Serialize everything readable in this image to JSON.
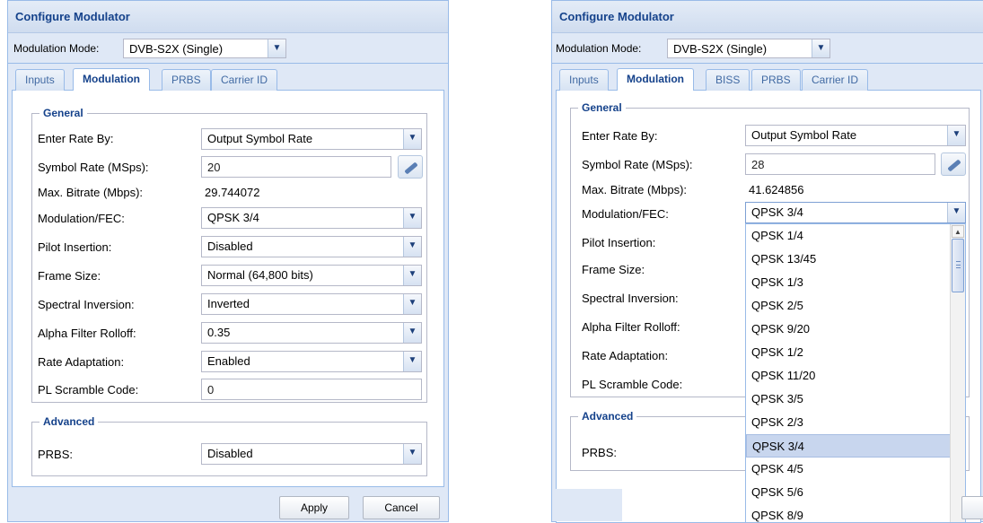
{
  "left": {
    "title": "Configure Modulator",
    "mode_label": "Modulation Mode:",
    "mode_value": "DVB-S2X (Single)",
    "tabs": [
      "Inputs",
      "Modulation",
      "PRBS",
      "Carrier ID"
    ],
    "general_legend": "General",
    "fields": {
      "enter_rate_by": {
        "label": "Enter Rate By:",
        "value": "Output Symbol Rate"
      },
      "symbol_rate": {
        "label": "Symbol Rate (MSps):",
        "value": "20"
      },
      "max_bitrate": {
        "label": "Max. Bitrate (Mbps):",
        "value": "29.744072"
      },
      "modulation_fec": {
        "label": "Modulation/FEC:",
        "value": "QPSK 3/4"
      },
      "pilot_insertion": {
        "label": "Pilot Insertion:",
        "value": "Disabled"
      },
      "frame_size": {
        "label": "Frame Size:",
        "value": "Normal (64,800 bits)"
      },
      "spectral_inversion": {
        "label": "Spectral Inversion:",
        "value": "Inverted"
      },
      "alpha_rolloff": {
        "label": "Alpha Filter Rolloff:",
        "value": "0.35"
      },
      "rate_adaptation": {
        "label": "Rate Adaptation:",
        "value": "Enabled"
      },
      "pl_scramble": {
        "label": "PL Scramble Code:",
        "value": "0"
      }
    },
    "advanced_legend": "Advanced",
    "prbs": {
      "label": "PRBS:",
      "value": "Disabled"
    },
    "apply_label": "Apply",
    "cancel_label": "Cancel"
  },
  "right": {
    "title": "Configure Modulator",
    "mode_label": "Modulation Mode:",
    "mode_value": "DVB-S2X (Single)",
    "tabs": [
      "Inputs",
      "Modulation",
      "BISS",
      "PRBS",
      "Carrier ID"
    ],
    "general_legend": "General",
    "fields": {
      "enter_rate_by": {
        "label": "Enter Rate By:",
        "value": "Output Symbol Rate"
      },
      "symbol_rate": {
        "label": "Symbol Rate (MSps):",
        "value": "28"
      },
      "max_bitrate": {
        "label": "Max. Bitrate (Mbps):",
        "value": "41.624856"
      },
      "modulation_fec": {
        "label": "Modulation/FEC:",
        "value": "QPSK 3/4"
      },
      "pilot_insertion": {
        "label": "Pilot Insertion:"
      },
      "frame_size": {
        "label": "Frame Size:"
      },
      "spectral_inversion": {
        "label": "Spectral Inversion:"
      },
      "alpha_rolloff": {
        "label": "Alpha Filter Rolloff:"
      },
      "rate_adaptation": {
        "label": "Rate Adaptation:"
      },
      "pl_scramble": {
        "label": "PL Scramble Code:"
      }
    },
    "advanced_legend": "Advanced",
    "prbs": {
      "label": "PRBS:"
    },
    "dropdown_options": [
      "QPSK 1/4",
      "QPSK 13/45",
      "QPSK 1/3",
      "QPSK 2/5",
      "QPSK 9/20",
      "QPSK 1/2",
      "QPSK 11/20",
      "QPSK 3/5",
      "QPSK 2/3",
      "QPSK 3/4",
      "QPSK 4/5",
      "QPSK 5/6",
      "QPSK 8/9"
    ],
    "dropdown_selected": "QPSK 3/4"
  },
  "colors": {
    "panel_bg": "#dfe8f6",
    "border": "#99bbe8",
    "title_text": "#15428b",
    "selected_item": "#c8d6ee"
  },
  "icons": {
    "combo_trigger": "chevron-down-icon",
    "calculator": "edit-pen-icon"
  }
}
